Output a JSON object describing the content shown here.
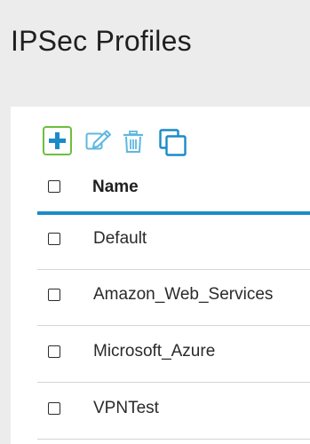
{
  "page": {
    "title": "IPSec Profiles"
  },
  "toolbar": {
    "buttons": [
      {
        "icon": "plus-icon",
        "color": "#1a8bc8"
      },
      {
        "icon": "edit-icon",
        "color": "#5fb8de"
      },
      {
        "icon": "trash-icon",
        "color": "#5fb8de"
      },
      {
        "icon": "clone-icon",
        "color": "#1a8bc8"
      }
    ],
    "highlight_color": "#6cbf3f"
  },
  "table": {
    "header": {
      "name_label": "Name"
    },
    "rows": [
      {
        "name": "Default"
      },
      {
        "name": "Amazon_Web_Services"
      },
      {
        "name": "Microsoft_Azure"
      },
      {
        "name": "VPNTest"
      }
    ],
    "accent_color": "#1a8bc8"
  }
}
